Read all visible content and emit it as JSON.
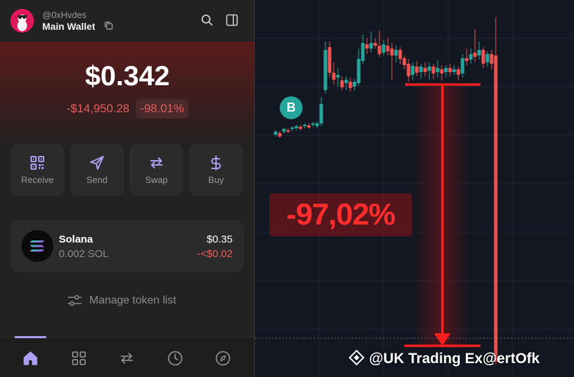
{
  "wallet": {
    "handle": "@0xHvdes",
    "name": "Main Wallet",
    "balance": "$0.342",
    "change_usd": "-$14,950.28",
    "change_pct": "-98.01%",
    "actions": [
      {
        "label": "Receive",
        "icon": "qr-code-icon"
      },
      {
        "label": "Send",
        "icon": "send-icon"
      },
      {
        "label": "Swap",
        "icon": "swap-icon"
      },
      {
        "label": "Buy",
        "icon": "dollar-icon"
      }
    ],
    "token": {
      "name": "Solana",
      "amount": "0.002 SOL",
      "value": "$0.35",
      "change": "-<$0.02"
    },
    "manage_label": "Manage token list",
    "nav": [
      "home-icon",
      "grid-icon",
      "swap-icon",
      "history-icon",
      "explore-icon"
    ]
  },
  "chart": {
    "drop_label": "-97,02%",
    "marker_label": "B",
    "watermark": "@UK Trading Ex@ertOfk"
  },
  "colors": {
    "up": "#26a69a",
    "down": "#ef5350",
    "accent": "#ab9ff2",
    "loss": "#eb5c5c"
  }
}
